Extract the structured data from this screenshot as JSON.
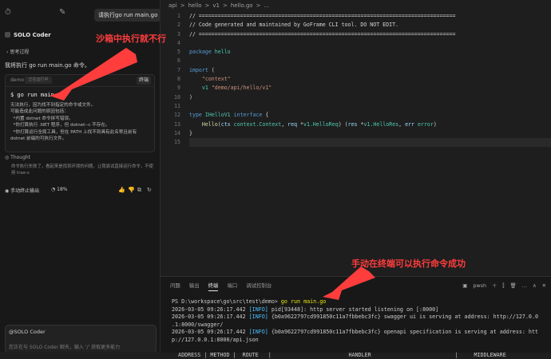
{
  "chat": {
    "user_message": "请执行go run main.go",
    "agent_name": "SOLO Coder",
    "thinking_label": "思考过程",
    "intro": "我将执行 go run main.go 命令。",
    "terminal_card": {
      "cwd_label": "demo",
      "path_placeholder": "正在运行中",
      "terminal_button": "终端",
      "command": "$ go run main.go",
      "output": "无法执行，因为找不到指定的命令或文件。\n可能造成此问题的原因包括：\n  *内置 dotnet 命令拼写错误。\n  *你打算执行 .NET 程序，但 dotnet--c 不存在。\n  *你打算运行全局工具，但在 PATH 上找不到具有此名称且前有\ndotnet 前缀的可执行文件。"
    },
    "thought_label": "Thought",
    "thought_text": "命令执行失败了，看起来是找到环境的问题。让我尝试直接运行命令，不使用 trae-s",
    "stop_label": "手动终止输出",
    "percent": "18%",
    "composer_agent": "@SOLO Coder",
    "composer_placeholder": "您正在与 SOLO Coder 聊天，输入 '/' 获取更多能力"
  },
  "annotations": {
    "sandbox_fail": "沙箱中执行就不行",
    "terminal_ok": "手动在终端可以执行命令成功"
  },
  "editor": {
    "breadcrumbs": [
      "api",
      ">",
      "hello",
      ">",
      "v1",
      ">",
      "hello.go",
      ">",
      "..."
    ],
    "line_numbers": [
      "1",
      "2",
      "3",
      "4",
      "5",
      "6",
      "7",
      "8",
      "9",
      "10",
      "11",
      "12",
      "13",
      "14",
      "15"
    ]
  },
  "panel": {
    "tabs": [
      "问题",
      "输出",
      "终端",
      "端口",
      "调试控制台"
    ],
    "active_tab": "终端",
    "shell": "pwsh",
    "prompt": "PS D:\\workspace\\go\\src\\test\\demo> ",
    "command": "go run main.go",
    "log_lines": [
      {
        "ts": "2026-03-05 09:26:17.442 ",
        "level": "[INFO]",
        "msg": " pid[93448]: http server started listening on [:8000]"
      },
      {
        "ts": "2026-03-05 09:26:17.442 ",
        "level": "[INFO]",
        "msg": " {b0a9622797cd991850c11a7fbbebc3fc} swagger ui is serving at address: http://127.0.0"
      },
      {
        "ts": "",
        "level": "",
        "msg": ".1:8000/swagger/"
      },
      {
        "ts": "2026-03-05 09:26:17.442 ",
        "level": "[INFO]",
        "msg": " {b0a9622797cd991850c11a7fbbebc3fc} openapi specification is serving at address: htt"
      },
      {
        "ts": "",
        "level": "",
        "msg": "p://127.0.0.1:8000/api.json"
      }
    ],
    "table_header": "  ADDRESS | METHOD |  ROUTE   |                        HANDLER                          |     MIDDLEWARE"
  },
  "colors": {
    "annotation": "#ff3d3d",
    "accent": "#569cd6"
  }
}
